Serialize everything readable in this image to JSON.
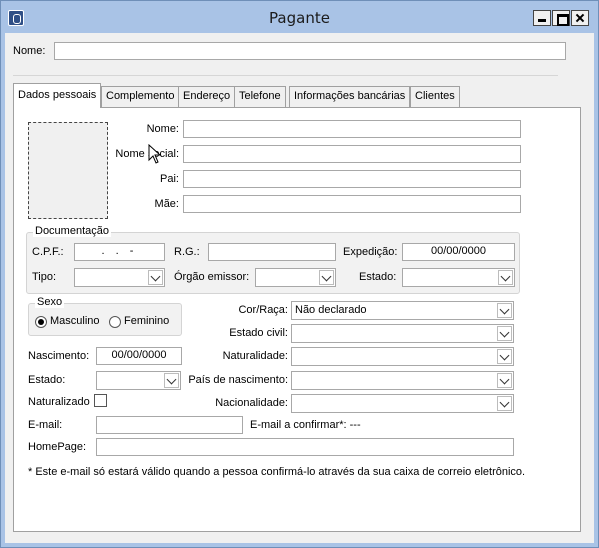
{
  "window": {
    "title": "Pagante"
  },
  "top": {
    "nome_label": "Nome:",
    "nome_value": ""
  },
  "tabs": [
    {
      "label": "Dados pessoais"
    },
    {
      "label": "Complemento"
    },
    {
      "label": "Endereço"
    },
    {
      "label": "Telefone"
    },
    {
      "label": "Informações bancárias"
    },
    {
      "label": "Clientes"
    }
  ],
  "pessoais": {
    "nome_label": "Nome:",
    "nome_social_label": "Nome social:",
    "pai_label": "Pai:",
    "mae_label": "Mãe:"
  },
  "documentacao": {
    "legend": "Documentação",
    "cpf_label": "C.P.F.:",
    "cpf_value": ". . -",
    "rg_label": "R.G.:",
    "expedicao_label": "Expedição:",
    "expedicao_value": "00/00/0000",
    "tipo_label": "Tipo:",
    "orgao_label": "Órgão emissor:",
    "estado_label": "Estado:"
  },
  "sexo": {
    "legend": "Sexo",
    "masculino": "Masculino",
    "feminino": "Feminino",
    "selected": "Masculino"
  },
  "outros": {
    "cor_raca_label": "Cor/Raça:",
    "cor_raca_value": "Não declarado",
    "estado_civil_label": "Estado civil:",
    "nascimento_label": "Nascimento:",
    "nascimento_value": "00/00/0000",
    "naturalidade_label": "Naturalidade:",
    "estado_label": "Estado:",
    "pais_label": "País de nascimento:",
    "naturalizado_label": "Naturalizado",
    "nacionalidade_label": "Nacionalidade:",
    "email_label": "E-mail:",
    "email_confirmar_label": "E-mail a confirmar*: ---",
    "homepage_label": "HomePage:",
    "footnote": "* Este e-mail só estará válido quando a pessoa confirmá-lo através da sua caixa de correio eletrônico."
  }
}
